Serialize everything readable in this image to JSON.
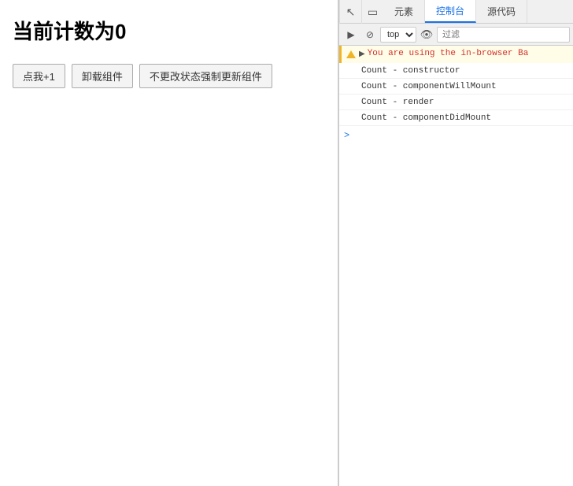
{
  "left": {
    "title": "当前计数为0",
    "buttons": [
      {
        "label": "点我+1",
        "name": "increment-button"
      },
      {
        "label": "卸载组件",
        "name": "unmount-button"
      },
      {
        "label": "不更改状态强制更新组件",
        "name": "force-update-button"
      }
    ]
  },
  "devtools": {
    "tabs": [
      {
        "label": "元素",
        "name": "elements-tab",
        "active": false
      },
      {
        "label": "控制台",
        "name": "console-tab",
        "active": true
      },
      {
        "label": "源代码",
        "name": "sources-tab",
        "active": false
      }
    ],
    "tab_icons": [
      {
        "icon": "▶",
        "name": "run-icon"
      },
      {
        "icon": "⊘",
        "name": "clear-icon"
      }
    ],
    "toolbar": {
      "top_label": "top",
      "filter_placeholder": "过滤"
    },
    "console": {
      "warning_text": "▶You are using the in-browser Ba",
      "log_lines": [
        "Count - constructor",
        "Count - componentWillMount",
        "Count - render",
        "Count - componentDidMount"
      ],
      "prompt_arrow": ">"
    }
  }
}
